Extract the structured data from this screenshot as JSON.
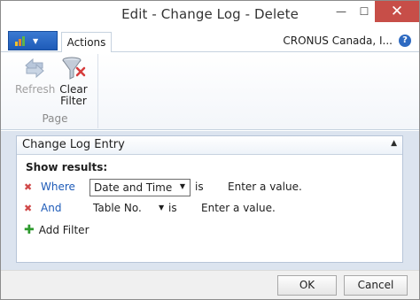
{
  "window": {
    "title": "Edit - Change Log - Delete",
    "minimize": "—",
    "maximize": "☐",
    "close": "✕"
  },
  "ribbon": {
    "app_menu_icon": "dynamics-logo-icon",
    "tab_actions": "Actions",
    "company": "CRONUS Canada, I...",
    "help_icon": "?",
    "group_label": "Page",
    "refresh_label": "Refresh",
    "clear_filter_label": "Clear\nFilter",
    "refresh_enabled": false
  },
  "panel": {
    "title": "Change Log Entry",
    "show_results": "Show results:",
    "filters": [
      {
        "conj": "Where",
        "field": "Date and Time",
        "operator": "is",
        "value": "Enter a value."
      },
      {
        "conj": "And",
        "field": "Table No.",
        "operator": "is",
        "value": "Enter a value."
      }
    ],
    "add_filter": "Add Filter"
  },
  "footer": {
    "ok": "OK",
    "cancel": "Cancel"
  },
  "colors": {
    "accent": "#1e5bb8",
    "close_button": "#c74e48",
    "content_bg": "#dce4ef",
    "remove_x": "#d04848",
    "add_plus": "#2d9a2d"
  }
}
